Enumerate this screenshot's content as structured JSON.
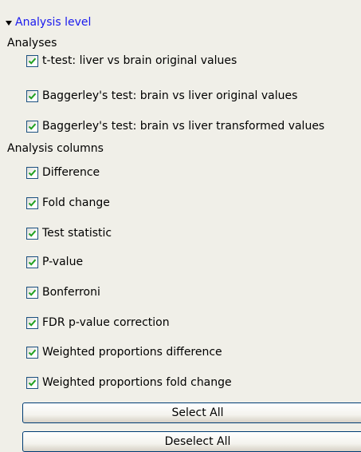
{
  "section": {
    "title": "Analysis level",
    "expanded": true
  },
  "analyses": {
    "label": "Analyses",
    "items": [
      {
        "label": "t-test: liver vs brain original values",
        "checked": true
      },
      {
        "label": "Baggerley's test: brain vs liver original values",
        "checked": true
      },
      {
        "label": "Baggerley's test: brain vs liver transformed values",
        "checked": true
      }
    ]
  },
  "analysis_columns": {
    "label": "Analysis columns",
    "items": [
      {
        "label": "Difference",
        "checked": true
      },
      {
        "label": "Fold change",
        "checked": true
      },
      {
        "label": "Test statistic",
        "checked": true
      },
      {
        "label": "P-value",
        "checked": true
      },
      {
        "label": "Bonferroni",
        "checked": true
      },
      {
        "label": "FDR p-value correction",
        "checked": true
      },
      {
        "label": "Weighted proportions difference",
        "checked": true
      },
      {
        "label": "Weighted proportions fold change",
        "checked": true
      }
    ]
  },
  "buttons": {
    "select_all": "Select All",
    "deselect_all": "Deselect All"
  },
  "colors": {
    "background": "#f0efe8",
    "header_link": "#1a1aee",
    "checkmark": "#21a121",
    "checkbox_border": "#1c5180"
  },
  "icons": {
    "expand": "triangle-down-icon",
    "check": "checkmark-icon"
  }
}
